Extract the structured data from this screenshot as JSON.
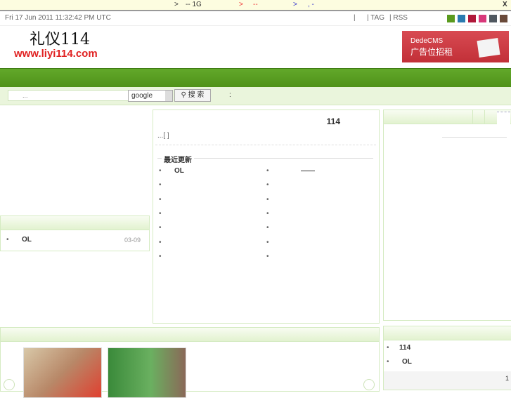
{
  "notice": {
    "a": ">",
    "b": "-- 1G",
    "c": ">",
    "d": "--",
    "e": ">",
    "f": ", -",
    "close": "X"
  },
  "topbar": {
    "date": "Fri 17 Jun 2011 11:32:42 PM UTC",
    "sep": "|",
    "tag": "| TAG",
    "rss": "| RSS",
    "colors": [
      "#5a9a1e",
      "#2a7ab0",
      "#b0183a",
      "#d8387a",
      "#505860",
      "#6a4a3a"
    ]
  },
  "header": {
    "logo_cn": "礼仪114",
    "logo_url": "www.liyi114.com",
    "ad_line1": "DedeCMS",
    "ad_line2": "广告位招租"
  },
  "search": {
    "placeholder": "...",
    "engine": "google",
    "button": "搜 索",
    "colon": ":"
  },
  "center": {
    "title": "114",
    "intro": "...[ ]",
    "recent_label": "最近更新",
    "left_items": [
      "OL",
      "",
      "",
      "",
      "",
      "",
      ""
    ],
    "right_items": [
      "——",
      "",
      "",
      "",
      "",
      "",
      ""
    ]
  },
  "left_box": {
    "item": "OL",
    "date": "03-09"
  },
  "right_bottom": {
    "items": [
      "114",
      "OL"
    ],
    "page": "1"
  }
}
